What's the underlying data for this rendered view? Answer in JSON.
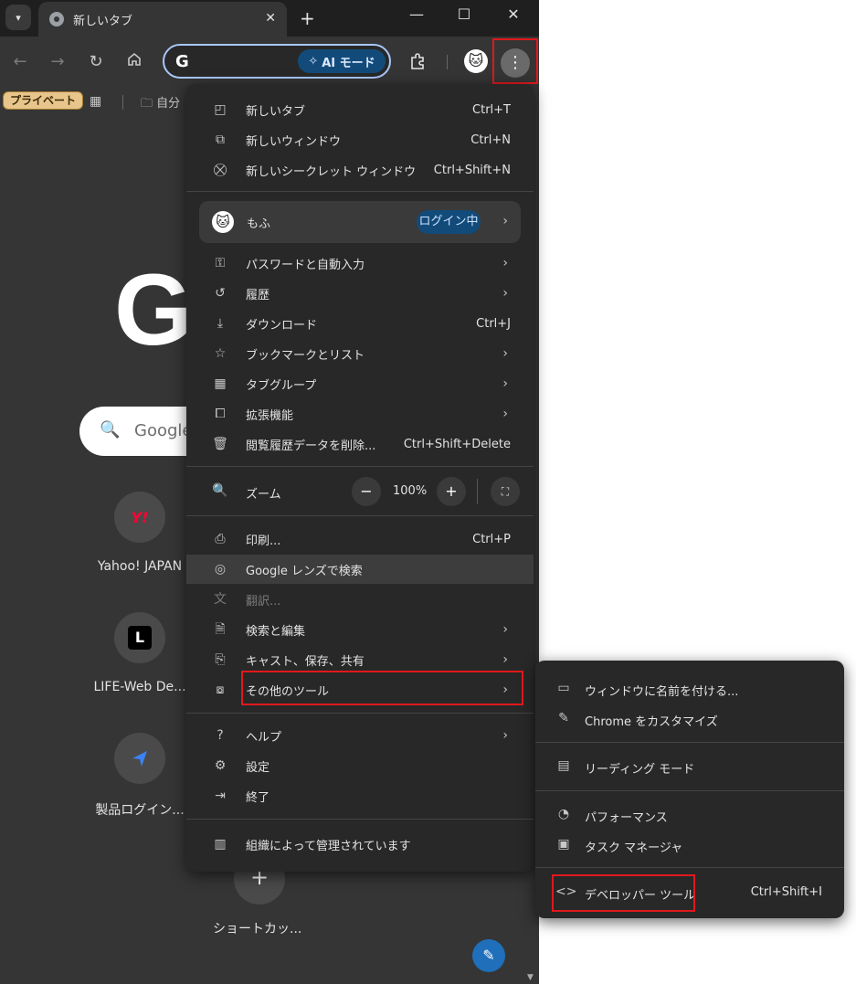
{
  "browser": {
    "tab_title": "新しいタブ",
    "omnibox_prefix": "G",
    "ai_mode_label": "AI モード",
    "private_badge": "プライベート",
    "bookmark_folder": "自分"
  },
  "ntp": {
    "logo": "G",
    "search_placeholder": "Google",
    "shortcuts": [
      {
        "label": "Yahoo! JAPAN",
        "glyph": "Y!"
      },
      {
        "label": "LIFE-Web De...",
        "glyph": "L"
      },
      {
        "label": "製品ログイン..."
      }
    ],
    "add_shortcut_label": "ショートカッ..."
  },
  "menu": {
    "new_tab": {
      "label": "新しいタブ",
      "shortcut": "Ctrl+T"
    },
    "new_window": {
      "label": "新しいウィンドウ",
      "shortcut": "Ctrl+N"
    },
    "new_incognito": {
      "label": "新しいシークレット ウィンドウ",
      "shortcut": "Ctrl+Shift+N"
    },
    "profile": {
      "name": "もふ",
      "status": "ログイン中"
    },
    "passwords": {
      "label": "パスワードと自動入力"
    },
    "history": {
      "label": "履歴"
    },
    "downloads": {
      "label": "ダウンロード",
      "shortcut": "Ctrl+J"
    },
    "bookmarks": {
      "label": "ブックマークとリスト"
    },
    "tab_groups": {
      "label": "タブグループ"
    },
    "extensions": {
      "label": "拡張機能"
    },
    "clear_data": {
      "label": "閲覧履歴データを削除...",
      "shortcut": "Ctrl+Shift+Delete"
    },
    "zoom": {
      "label": "ズーム",
      "value": "100%"
    },
    "print": {
      "label": "印刷...",
      "shortcut": "Ctrl+P"
    },
    "lens": {
      "label": "Google レンズで検索"
    },
    "translate": {
      "label": "翻訳..."
    },
    "search_edit": {
      "label": "検索と編集"
    },
    "cast_save_share": {
      "label": "キャスト、保存、共有"
    },
    "more_tools": {
      "label": "その他のツール"
    },
    "help": {
      "label": "ヘルプ"
    },
    "settings": {
      "label": "設定"
    },
    "exit": {
      "label": "終了"
    },
    "managed": {
      "label": "組織によって管理されています"
    }
  },
  "submenu": {
    "name_window": {
      "label": "ウィンドウに名前を付ける..."
    },
    "customize_chrome": {
      "label": "Chrome をカスタマイズ"
    },
    "reading_mode": {
      "label": "リーディング モード"
    },
    "performance": {
      "label": "パフォーマンス"
    },
    "task_manager": {
      "label": "タスク マネージャ"
    },
    "dev_tools": {
      "label": "デベロッパー ツール",
      "shortcut": "Ctrl+Shift+I"
    }
  },
  "colors": {
    "highlight_box": "#e0191c",
    "accent_blue": "#124b7a"
  }
}
